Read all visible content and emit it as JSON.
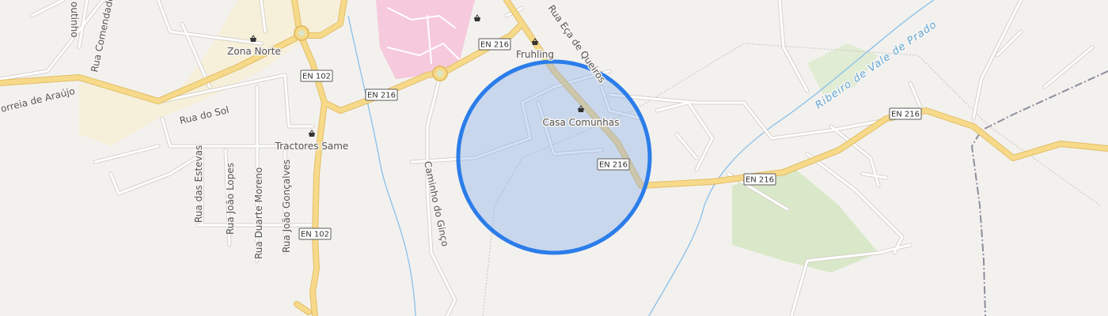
{
  "map": {
    "streets": {
      "rua_comendador": "Rua Comendador",
      "outinho": "outinho",
      "correia_de_araujo": "orreia de Araújo",
      "rua_do_sol": "Rua do Sol",
      "rua_eca_de_queiros": "Rua Eça de Queiros",
      "caminho_do_ginco": "Caminho do Ginço",
      "rua_das_estevas": "Rua das Estevas",
      "rua_joao_lopes": "Rua João Lopes",
      "rua_duarte_moreno": "Rua Duarte Moreno",
      "rua_joao_goncalves": "Rua João Gonçalves"
    },
    "waterways": {
      "ribeiro_de_vale_de_prado": "Ribeiro de Vale de Prado"
    },
    "road_shields": {
      "en216_a": "EN 216",
      "en216_b": "EN 216",
      "en216_c": "EN 216",
      "en216_d": "EN 216",
      "en216_e": "EN 216",
      "en102_a": "EN 102",
      "en102_b": "EN 102"
    },
    "pois": {
      "zona_norte": "Zona Norte",
      "tractores_same": "Tractores Same",
      "fruhling": "Fruhling",
      "casa_comunhas": "Casa Comunhas"
    },
    "colors": {
      "background": "#f3f1ee",
      "main_road": "#f7d98a",
      "main_road_casing": "#e2bf66",
      "minor_road": "#ffffff",
      "water": "#8ec3ea",
      "park": "#d9e8c8",
      "hospital": "#f6c9dc",
      "location_fill": "#7aa7ec",
      "location_stroke": "#2b7de9",
      "railway": "#8d8d9d"
    }
  }
}
